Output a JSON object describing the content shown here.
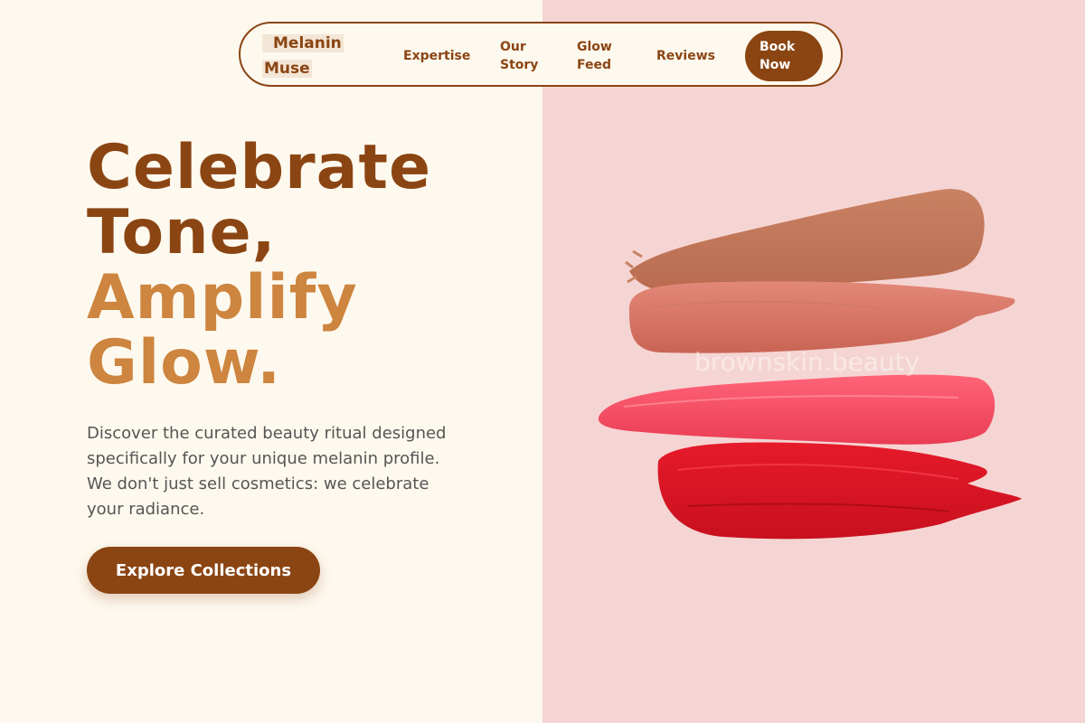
{
  "brand": {
    "name_line1": "Melanin",
    "name_line2": "Muse"
  },
  "nav": {
    "links": [
      {
        "label": "Expertise"
      },
      {
        "label": "Our Story"
      },
      {
        "label": "Glow Feed"
      },
      {
        "label": "Reviews"
      }
    ],
    "cta_label": "Book Now"
  },
  "hero": {
    "headline_line1": "Celebrate",
    "headline_line2": "Tone,",
    "headline_line3": "Amplify",
    "headline_line4": "Glow.",
    "description": "Discover the curated beauty ritual designed specifically for your unique melanin profile. We don't just sell cosmetics: we celebrate your radiance.",
    "cta_label": "Explore Collections",
    "image_watermark": "brownskin.beauty"
  },
  "colors": {
    "primary": "#8b4513",
    "accent": "#cd853f",
    "cream_bg": "#fef9ee",
    "pink_bg": "#f5d5d3"
  }
}
